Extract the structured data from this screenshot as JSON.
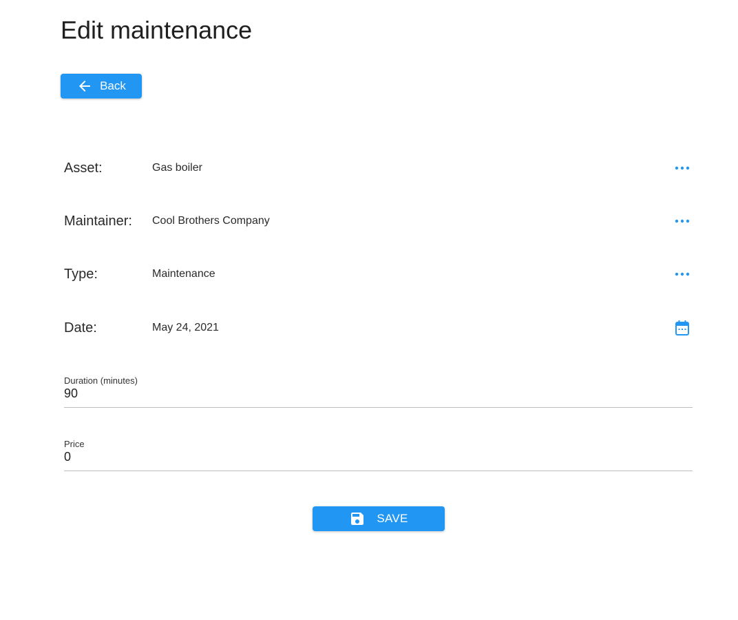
{
  "page": {
    "title": "Edit maintenance"
  },
  "back_button": {
    "label": "Back",
    "icon": "arrow-left-icon"
  },
  "fields": {
    "asset": {
      "label": "Asset:",
      "value": "Gas boiler",
      "action_icon": "more-horizontal-icon"
    },
    "maintainer": {
      "label": "Maintainer:",
      "value": "Cool Brothers Company",
      "action_icon": "more-horizontal-icon"
    },
    "type": {
      "label": "Type:",
      "value": "Maintenance",
      "action_icon": "more-horizontal-icon"
    },
    "date": {
      "label": "Date:",
      "value": "May 24, 2021",
      "action_icon": "calendar-icon"
    }
  },
  "inputs": {
    "duration": {
      "label": "Duration (minutes)",
      "value": "90"
    },
    "price": {
      "label": "Price",
      "value": "0"
    }
  },
  "save_button": {
    "label": "SAVE",
    "icon": "floppy-disk-icon"
  },
  "colors": {
    "accent": "#2196f3",
    "divider": "#bdbdbd",
    "text": "#222222"
  }
}
